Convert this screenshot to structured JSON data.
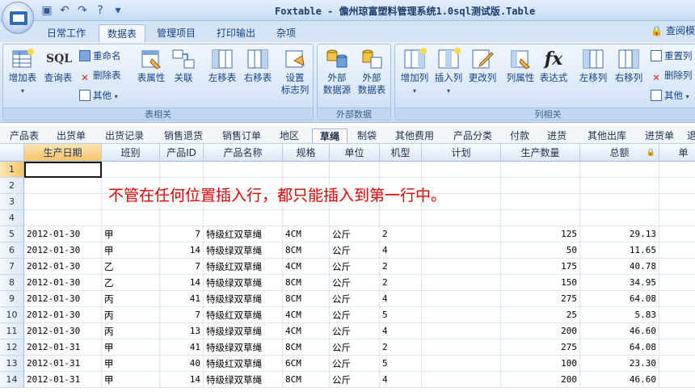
{
  "titlebar": {
    "title": "Foxtable - 儋州琼富塑料管理系统1.0sql测试版.Table",
    "qat_icons": [
      "save-icon",
      "undo-icon",
      "redo-icon",
      "help-icon",
      "customize-icon"
    ]
  },
  "ribbon_tabs": [
    "日常工作",
    "数据表",
    "管理项目",
    "打印输出",
    "杂项"
  ],
  "active_tab": "数据表",
  "help_link": "查阅模",
  "ribbon": {
    "group_table": {
      "label": "表相关",
      "add_table": "增加表",
      "query_table": "查询表",
      "sql_text": "SQL",
      "rename": "重命名",
      "delete_table": "删除表",
      "other": "其他",
      "table_props": "表属性",
      "relation": "关联",
      "move_left": "左移表",
      "move_right": "右移表",
      "set_flag_col_1": "设置",
      "set_flag_col_2": "标志列"
    },
    "group_external": {
      "label": "外部数据",
      "ext_source_1": "外部",
      "ext_source_2": "数据源",
      "ext_table_1": "外部",
      "ext_table_2": "数据表"
    },
    "group_column": {
      "label": "列相关",
      "add_col": "增加列",
      "insert_col": "插入列",
      "modify_col": "更改列",
      "col_props": "列属性",
      "expression": "表达式",
      "fx_text": "fx",
      "move_col_left": "左移列",
      "move_col_right": "右移列",
      "reset_col": "重置列",
      "delete_col": "删除列",
      "other": "其他"
    }
  },
  "sheet_tabs": [
    "产品表",
    "出货单",
    "出货记录",
    "销售退货",
    "销售订单",
    "地区",
    "草绳",
    "制袋",
    "其他费用",
    "产品分类",
    "付款",
    "进货",
    "其他出库",
    "进货单",
    "退"
  ],
  "active_sheet": "草绳",
  "columns": [
    "生产日期",
    "班别",
    "产品ID",
    "产品名称",
    "规格",
    "单位",
    "机型",
    "计划",
    "生产数量",
    "总额",
    "单"
  ],
  "annotation": "不管在任何位置插入行，都只能插入到第一行中。",
  "rows": [
    {
      "n": "1",
      "cells": [
        "",
        "",
        "",
        "",
        "",
        "",
        "",
        "",
        "",
        ""
      ]
    },
    {
      "n": "2",
      "cells": [
        "",
        "",
        "",
        "",
        "",
        "",
        "",
        "",
        "",
        ""
      ]
    },
    {
      "n": "3",
      "cells": [
        "",
        "",
        "",
        "",
        "",
        "",
        "",
        "",
        "",
        ""
      ]
    },
    {
      "n": "4",
      "cells": [
        "",
        "",
        "",
        "",
        "",
        "",
        "",
        "",
        "",
        ""
      ]
    },
    {
      "n": "5",
      "cells": [
        "2012-01-30",
        "甲",
        "7",
        "特级红双草绳",
        "4CM",
        "公斤",
        "2",
        "",
        "125",
        "29.13"
      ]
    },
    {
      "n": "6",
      "cells": [
        "2012-01-30",
        "甲",
        "14",
        "特级绿双草绳",
        "8CM",
        "公斤",
        "4",
        "",
        "50",
        "11.65"
      ]
    },
    {
      "n": "7",
      "cells": [
        "2012-01-30",
        "乙",
        "7",
        "特级红双草绳",
        "4CM",
        "公斤",
        "2",
        "",
        "175",
        "40.78"
      ]
    },
    {
      "n": "8",
      "cells": [
        "2012-01-30",
        "乙",
        "14",
        "特级绿双草绳",
        "8CM",
        "公斤",
        "2",
        "",
        "150",
        "34.95"
      ]
    },
    {
      "n": "9",
      "cells": [
        "2012-01-30",
        "丙",
        "41",
        "特级绿双草绳",
        "8CM",
        "公斤",
        "4",
        "",
        "275",
        "64.08"
      ]
    },
    {
      "n": "10",
      "cells": [
        "2012-01-30",
        "丙",
        "7",
        "特级红双草绳",
        "4CM",
        "公斤",
        "5",
        "",
        "25",
        "5.83"
      ]
    },
    {
      "n": "11",
      "cells": [
        "2012-01-30",
        "丙",
        "13",
        "特级绿双草绳",
        "4CM",
        "公斤",
        "4",
        "",
        "200",
        "46.60"
      ]
    },
    {
      "n": "12",
      "cells": [
        "2012-01-31",
        "甲",
        "41",
        "特级绿双草绳",
        "8CM",
        "公斤",
        "2",
        "",
        "275",
        "64.08"
      ]
    },
    {
      "n": "13",
      "cells": [
        "2012-01-31",
        "甲",
        "40",
        "特级红双草绳",
        "6CM",
        "公斤",
        "5",
        "",
        "100",
        "23.30"
      ]
    },
    {
      "n": "14",
      "cells": [
        "2012-01-31",
        "甲",
        "14",
        "特级绿双草绳",
        "8CM",
        "公斤",
        "4",
        "",
        "200",
        "46.60"
      ]
    }
  ]
}
